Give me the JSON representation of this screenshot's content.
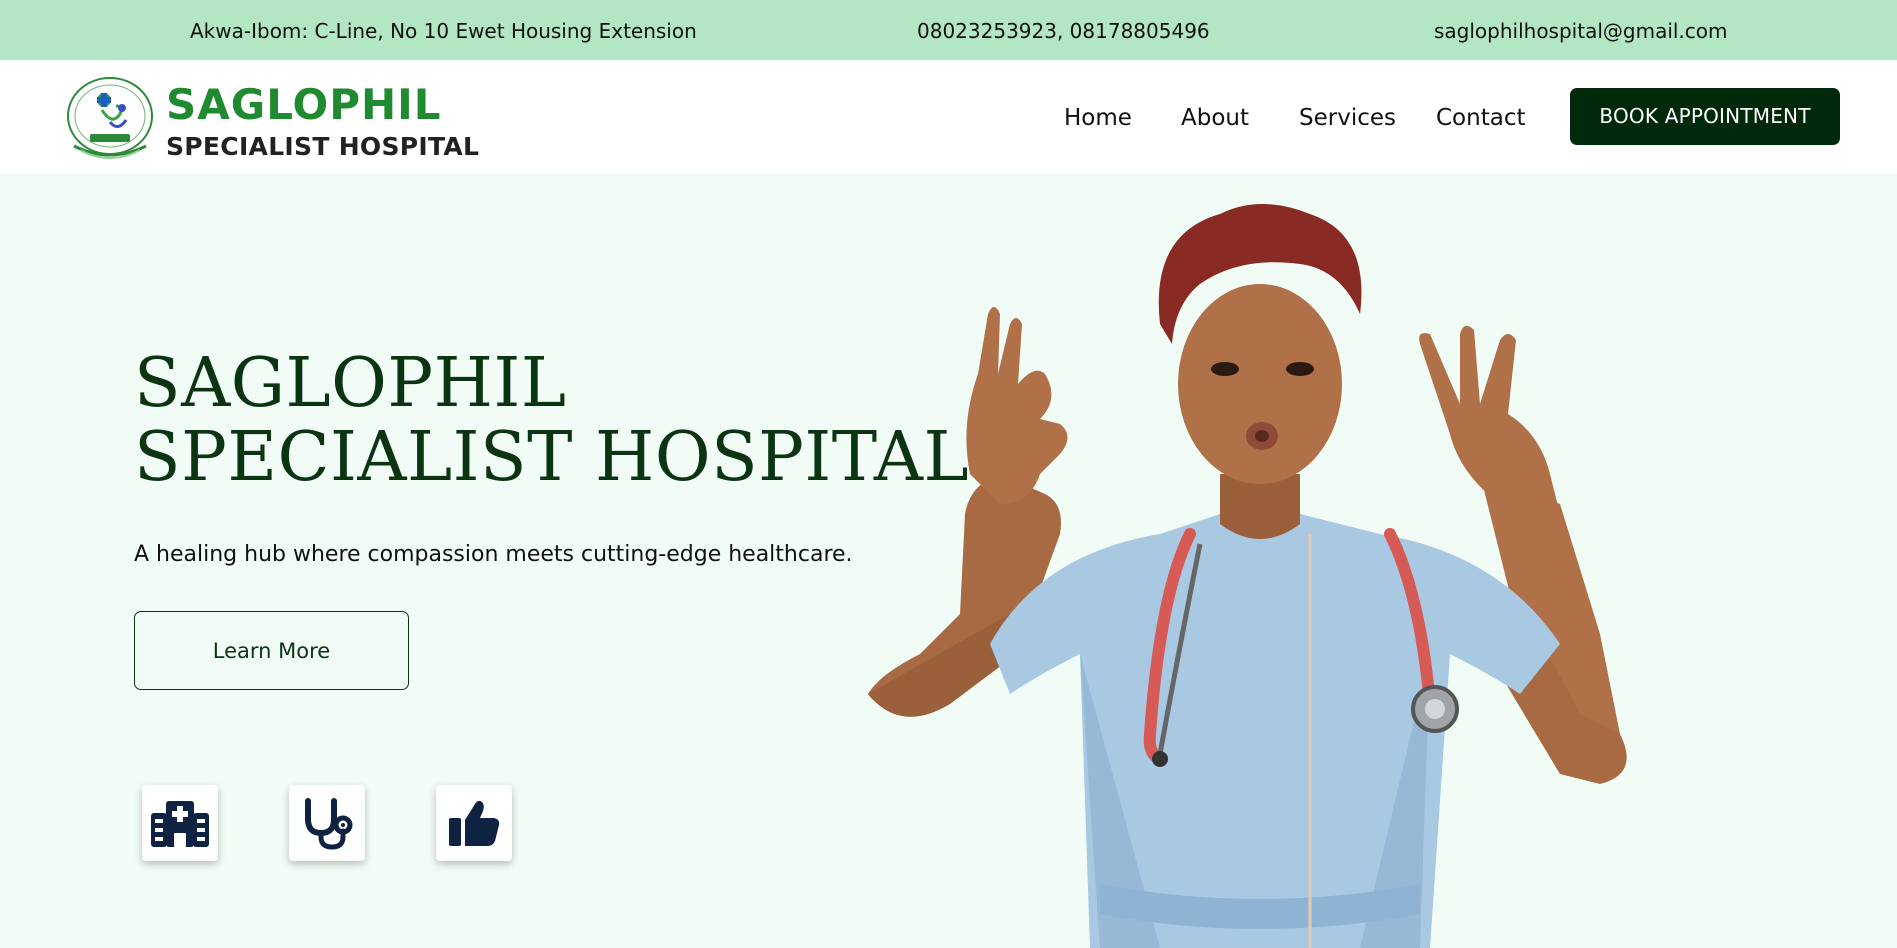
{
  "topbar": {
    "address": "Akwa-Ibom: C-Line, No 10 Ewet Housing Extension",
    "phone": "08023253923, 08178805496",
    "email": "saglophilhospital@gmail.com"
  },
  "header": {
    "logo": {
      "name": "SAGLOPHIL",
      "subtitle": "SPECIALIST HOSPITAL",
      "emblem_icon": "hospital-logo-emblem"
    },
    "nav": [
      {
        "label": "Home"
      },
      {
        "label": "About"
      },
      {
        "label": "Services"
      },
      {
        "label": "Contact"
      }
    ],
    "cta_label": "BOOK APPOINTMENT"
  },
  "hero": {
    "title_line1": "SAGLOPHIL",
    "title_line2": "SPECIALIST HOSPITAL",
    "tagline": "A healing hub where compassion meets cutting-edge healthcare.",
    "button_label": "Learn More",
    "features": [
      {
        "icon": "hospital-building-icon"
      },
      {
        "icon": "stethoscope-icon"
      },
      {
        "icon": "thumbs-up-icon"
      }
    ],
    "image": "nurse-in-blue-scrubs-with-stethoscope"
  },
  "colors": {
    "topbar_bg": "#b3e6c2",
    "brand_green": "#1f8a2f",
    "dark_green": "#00290a",
    "hero_bg": "#f1fcf6",
    "icon_navy": "#0e2342"
  }
}
